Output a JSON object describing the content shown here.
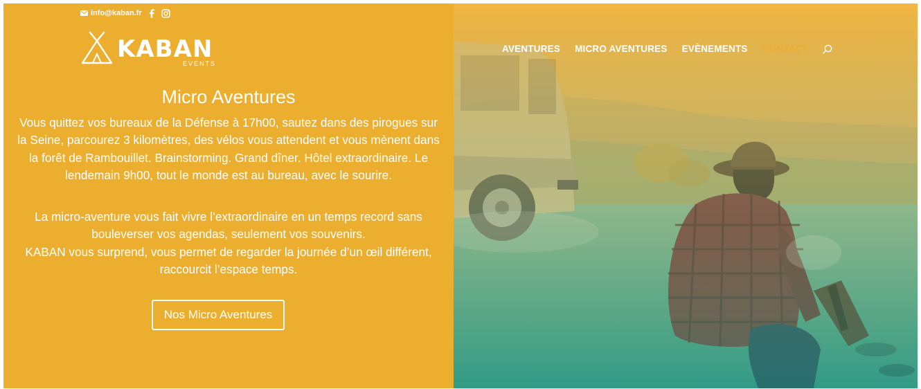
{
  "topbar": {
    "email": "info@kaban.fr",
    "icons": [
      "mail-icon",
      "facebook-icon",
      "instagram-icon"
    ]
  },
  "logo": {
    "word": "KABAN",
    "sub": "EVENTS"
  },
  "hero": {
    "title": "Micro Aventures",
    "paragraph_1": "Vous quittez vos bureaux de la Défense à 17h00, sautez dans des pirogues sur la Seine, parcourez 3 kilomètres, des vélos vous attendent et vous mènent dans la forêt de Rambouillet. Brainstorming. Grand dîner. Hôtel extraordinaire. Le lendemain 9h00, tout le monde est au bureau, avec le sourire.",
    "paragraph_2_line_1": "La micro-aventure vous fait vivre l’extraordinaire en un temps record sans bouleverser vos agendas, seulement vos souvenirs.",
    "paragraph_2_line_2": "KABAN vous surprend, vous permet de regarder la journée d’un œil différent, raccourcit l’espace temps.",
    "cta": "Nos Micro Aventures"
  },
  "nav": {
    "items": [
      "AVENTURES",
      "MICRO AVENTURES",
      "EVÈNEMENTS",
      "CONTACT"
    ],
    "search_icon": "search-icon"
  },
  "colors": {
    "brand_yellow": "#ecae2f",
    "overlay_teal": "#2aa58c",
    "text": "#ffffff"
  }
}
